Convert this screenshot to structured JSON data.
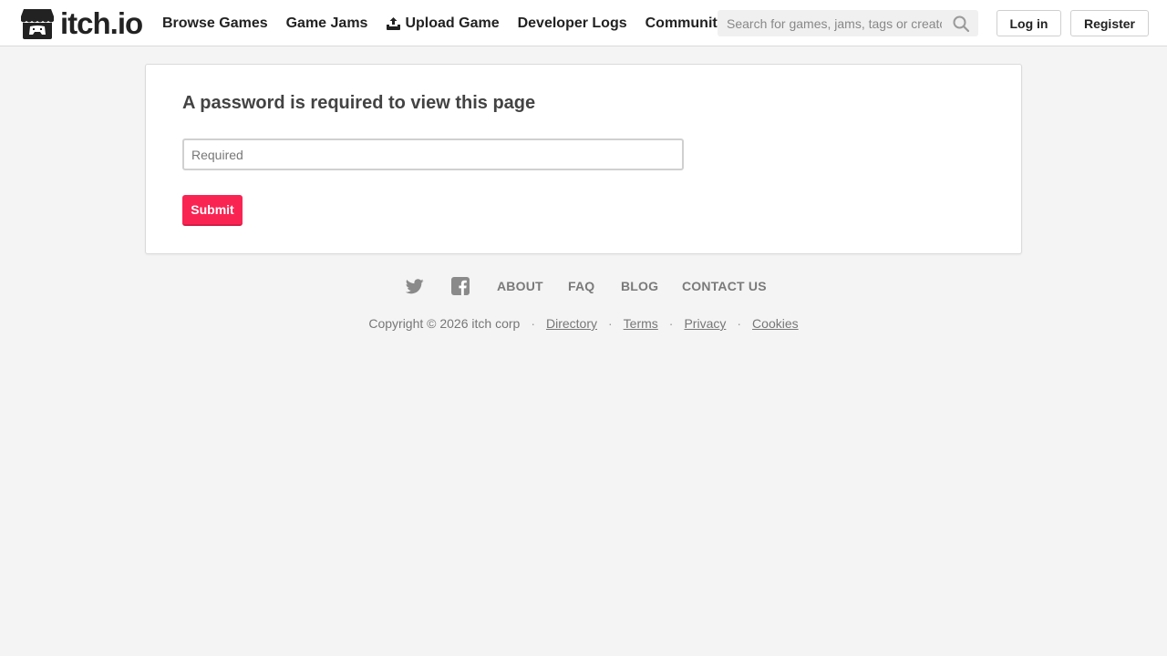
{
  "header": {
    "logo_text": "itch.io",
    "nav": [
      {
        "label": "Browse Games"
      },
      {
        "label": "Game Jams"
      },
      {
        "label": "Upload Game"
      },
      {
        "label": "Developer Logs"
      },
      {
        "label": "Community"
      }
    ],
    "search": {
      "placeholder": "Search for games, jams, tags or creators",
      "value": ""
    },
    "login_label": "Log in",
    "register_label": "Register"
  },
  "main": {
    "title": "A password is required to view this page",
    "password_placeholder": "Required",
    "submit_label": "Submit"
  },
  "footer": {
    "links": [
      {
        "label": "ABOUT"
      },
      {
        "label": "FAQ"
      },
      {
        "label": "BLOG"
      },
      {
        "label": "CONTACT US"
      }
    ],
    "copyright": "Copyright © 2026 itch corp",
    "legal_links": [
      {
        "label": "Directory"
      },
      {
        "label": "Terms"
      },
      {
        "label": "Privacy"
      },
      {
        "label": "Cookies"
      }
    ]
  },
  "colors": {
    "accent": "#fa2453",
    "background": "#f4f4f4",
    "text": "#222222",
    "muted": "#7a7a7a"
  },
  "icons": [
    "itchio-logo-icon",
    "upload-icon",
    "search-icon",
    "twitter-icon",
    "facebook-icon"
  ]
}
